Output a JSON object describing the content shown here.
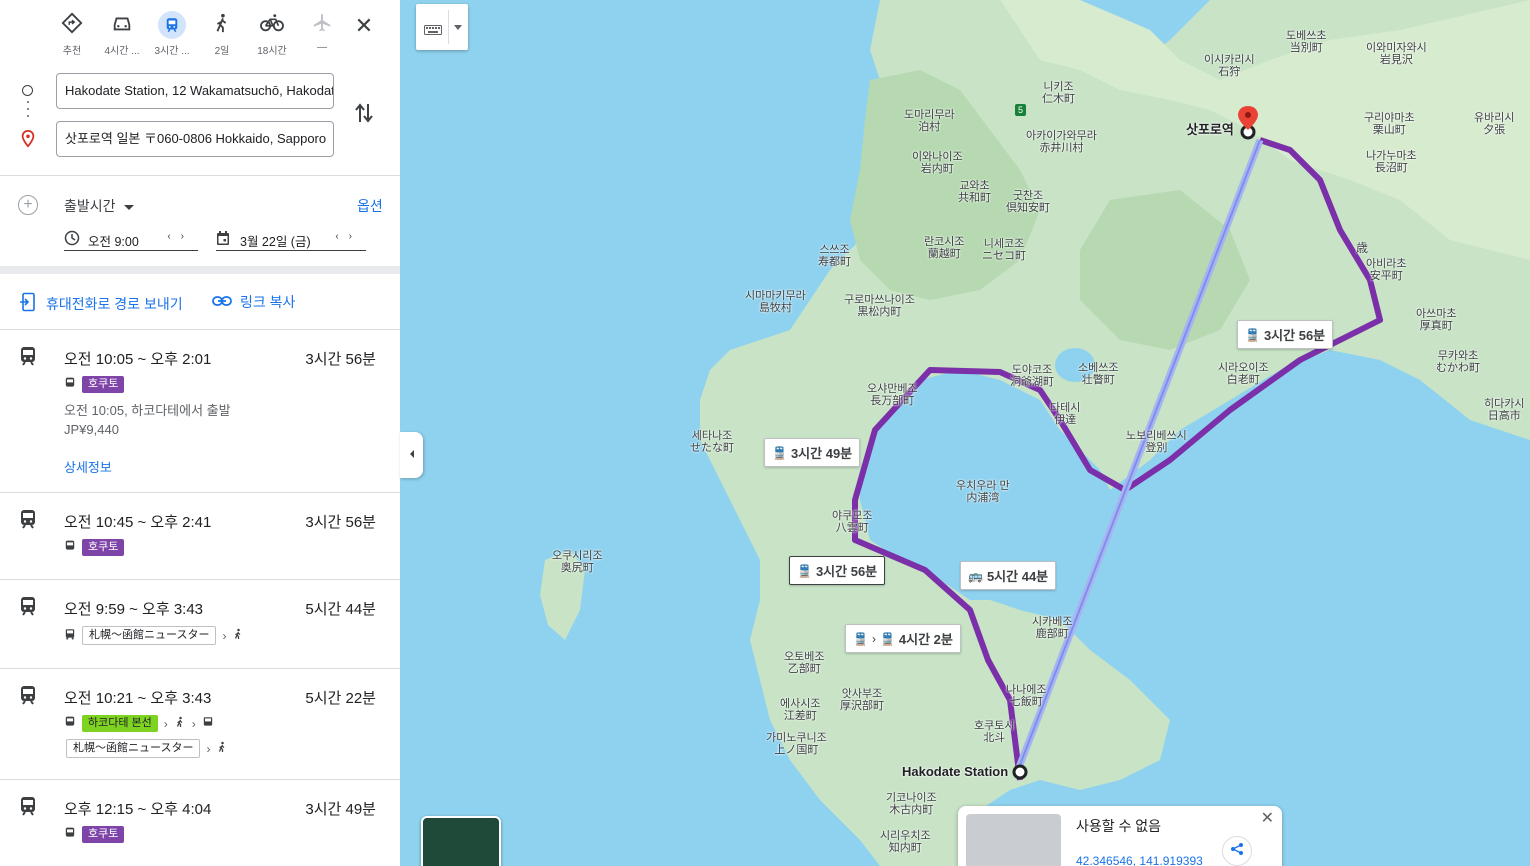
{
  "modes": [
    {
      "label": "추천",
      "icon": "directions-icon"
    },
    {
      "label": "4시간 ...",
      "icon": "car-icon"
    },
    {
      "label": "3시간 ...",
      "icon": "transit-icon"
    },
    {
      "label": "2일",
      "icon": "walk-icon"
    },
    {
      "label": "18시간",
      "icon": "bicycle-icon"
    },
    {
      "label": "—",
      "icon": "flight-icon"
    }
  ],
  "origin": "Hakodate Station, 12 Wakamatsuchō, Hakodate",
  "destination": "삿포로역 일본 〒060-0806 Hokkaido, Sapporo",
  "depart_label": "출발시간",
  "options_label": "옵션",
  "time_value": "오전 9:00",
  "date_value": "3월 22일 (금)",
  "send_to_phone": "휴대전화로 경로 보내기",
  "copy_link": "링크 복사",
  "routes": [
    {
      "times": "오전 10:05 ~ 오후 2:01",
      "duration": "3시간 56분",
      "line": "호쿠토",
      "depart_text": "오전 10:05, 하코다테에서 출발",
      "fare": "JP¥9,440",
      "details": "상세정보"
    },
    {
      "times": "오전 10:45 ~ 오후 2:41",
      "duration": "3시간 56분",
      "line": "호쿠토"
    },
    {
      "times": "오전 9:59 ~ 오후 3:43",
      "duration": "5시간 44분",
      "bus": "札幌〜函館ニュースター"
    },
    {
      "times": "오전 10:21 ~ 오후 3:43",
      "duration": "5시간 22분",
      "line": "하코다테 본선",
      "bus": "札幌〜函館ニュースター"
    },
    {
      "times": "오후 12:15 ~ 오후 4:04",
      "duration": "3시간 49분",
      "line": "호쿠토"
    }
  ],
  "map": {
    "place_labels": [
      {
        "ko": "도마리무라",
        "jp": "泊村"
      },
      {
        "ko": "이와나이조",
        "jp": "岩内町"
      },
      {
        "ko": "교와초",
        "jp": "共和町"
      },
      {
        "ko": "니키조",
        "jp": "仁木町"
      },
      {
        "ko": "아카이가와무라",
        "jp": "赤井川村"
      },
      {
        "ko": "굿찬조",
        "jp": "倶知安町"
      },
      {
        "ko": "란코시조",
        "jp": "蘭越町"
      },
      {
        "ko": "니세코조",
        "jp": "ニセコ町"
      },
      {
        "ko": "스쓰조",
        "jp": "寿都町"
      },
      {
        "ko": "시마마키무라",
        "jp": "島牧村"
      },
      {
        "ko": "구로마쓰나이조",
        "jp": "黒松内町"
      },
      {
        "ko": "오샤만베조",
        "jp": "長万部町"
      },
      {
        "ko": "도야코조",
        "jp": "洞爺湖町"
      },
      {
        "ko": "소베쓰조",
        "jp": "壮瞥町"
      },
      {
        "ko": "다테시",
        "jp": "伊達"
      },
      {
        "ko": "세타나조",
        "jp": "せたな町"
      },
      {
        "ko": "노보리베쓰시",
        "jp": "登別"
      },
      {
        "ko": "시라오이조",
        "jp": "白老町"
      },
      {
        "ko": "우치우라 만",
        "jp": "内浦湾"
      },
      {
        "ko": "야쿠모조",
        "jp": "八雲町"
      },
      {
        "ko": "오쿠시리조",
        "jp": "奥尻町"
      },
      {
        "ko": "오토베조",
        "jp": "乙部町"
      },
      {
        "ko": "에사시조",
        "jp": "江差町"
      },
      {
        "ko": "앗사부조",
        "jp": "厚沢部町"
      },
      {
        "ko": "가미노쿠니조",
        "jp": "上ノ国町"
      },
      {
        "ko": "시카베조",
        "jp": "鹿部町"
      },
      {
        "ko": "나나에조",
        "jp": "七飯町"
      },
      {
        "ko": "호쿠토시",
        "jp": "北斗"
      },
      {
        "ko": "기코나이조",
        "jp": "木古内町"
      },
      {
        "ko": "시리우치조",
        "jp": "知内町"
      },
      {
        "ko": "이시카리시",
        "jp": "石狩"
      },
      {
        "ko": "도베쓰초",
        "jp": "当別町"
      },
      {
        "ko": "이와미자와시",
        "jp": "岩見沢"
      },
      {
        "ko": "구리야마초",
        "jp": "栗山町"
      },
      {
        "ko": "유바리시",
        "jp": "夕張"
      },
      {
        "ko": "나가누마초",
        "jp": "長沼町"
      },
      {
        "ko": "아비라초",
        "jp": "安平町"
      },
      {
        "ko": "아쓰마초",
        "jp": "厚真町"
      },
      {
        "ko": "무카와초",
        "jp": "むかわ町"
      },
      {
        "ko": "히다카시",
        "jp": "日高市"
      }
    ],
    "sapporo_label": "삿포로역",
    "hakodate_label": "Hakodate Station",
    "chitose_label": "歳",
    "route_labels": [
      "3시간 56분",
      "3시간 49분",
      "3시간 56분",
      "5시간 44분",
      "4시간 2분"
    ],
    "road_label": "5",
    "infocard": {
      "title": "사용할 수 없음",
      "coord": "42.346546, 141.919393"
    }
  }
}
